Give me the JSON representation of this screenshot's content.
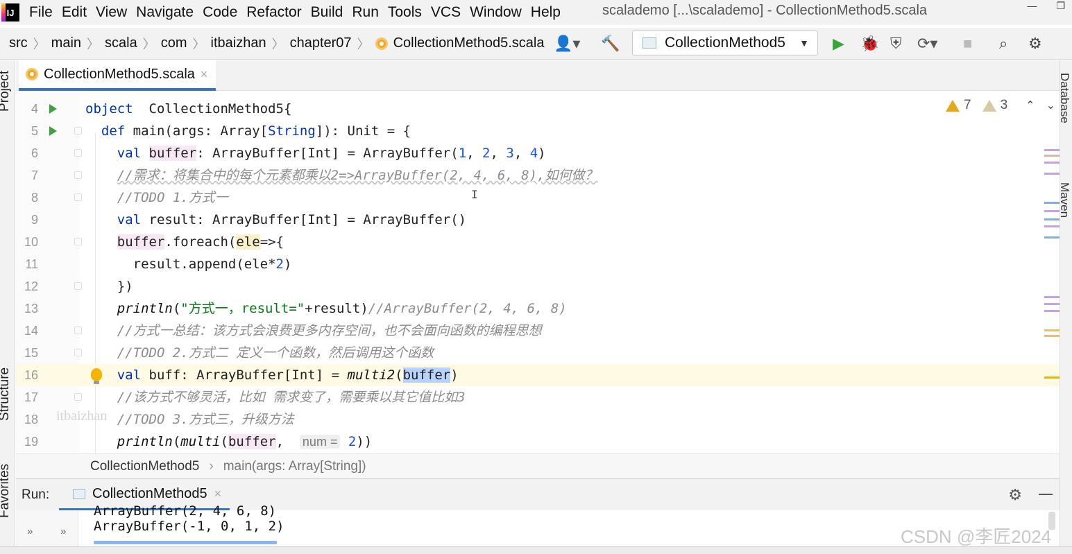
{
  "menubar": {
    "items": [
      "File",
      "Edit",
      "View",
      "Navigate",
      "Code",
      "Refactor",
      "Build",
      "Run",
      "Tools",
      "VCS",
      "Window",
      "Help"
    ],
    "window_title": "scalademo [...\\scalademo] - CollectionMethod5.scala"
  },
  "breadcrumb": [
    "src",
    "main",
    "scala",
    "com",
    "itbaizhan",
    "chapter07",
    "CollectionMethod5.scala"
  ],
  "run_config": {
    "label": "CollectionMethod5"
  },
  "left_tools": [
    "Project",
    "Structure",
    "Favorites"
  ],
  "right_tools": [
    "Database",
    "Maven"
  ],
  "editor": {
    "tab_label": "CollectionMethod5.scala",
    "inspections": {
      "warnings": "7",
      "weak_warnings": "3"
    },
    "lines": [
      {
        "n": "4",
        "segs": [
          [
            "kw",
            "object"
          ],
          [
            "",
            "  CollectionMethod5{"
          ]
        ]
      },
      {
        "n": "5",
        "segs": [
          [
            "",
            "  "
          ],
          [
            "kw",
            "def"
          ],
          [
            "",
            " main(args: Array["
          ],
          [
            "kw",
            "String"
          ],
          [
            "",
            "]): Unit = {"
          ]
        ]
      },
      {
        "n": "6",
        "segs": [
          [
            "",
            "    "
          ],
          [
            "kw",
            "val"
          ],
          [
            "",
            " "
          ],
          [
            "hl-var",
            "buffer"
          ],
          [
            "",
            ": ArrayBuffer[Int] = ArrayBuffer("
          ],
          [
            "num",
            "1"
          ],
          [
            "",
            ", "
          ],
          [
            "num",
            "2"
          ],
          [
            "",
            ", "
          ],
          [
            "num",
            "3"
          ],
          [
            "",
            ", "
          ],
          [
            "num",
            "4"
          ],
          [
            "",
            ")"
          ]
        ]
      },
      {
        "n": "7",
        "segs": [
          [
            "",
            "    "
          ],
          [
            "cmt squiggle",
            "//需求：将集合中的每个元素都乘以2=>ArrayBuffer(2, 4, 6, 8),如何做？"
          ]
        ]
      },
      {
        "n": "8",
        "segs": [
          [
            "",
            "    "
          ],
          [
            "cmt",
            "//TODO 1.方式一"
          ]
        ]
      },
      {
        "n": "9",
        "segs": [
          [
            "",
            "    "
          ],
          [
            "kw",
            "val"
          ],
          [
            "",
            " result: ArrayBuffer[Int] = ArrayBuffer()"
          ]
        ]
      },
      {
        "n": "10",
        "segs": [
          [
            "",
            "    "
          ],
          [
            "hl-var",
            "buffer"
          ],
          [
            "",
            ".foreach("
          ],
          [
            "hl-ele",
            "ele"
          ],
          [
            "",
            "=>{"
          ]
        ]
      },
      {
        "n": "11",
        "segs": [
          [
            "",
            "      result.append(ele*"
          ],
          [
            "num",
            "2"
          ],
          [
            "",
            ")"
          ]
        ]
      },
      {
        "n": "12",
        "segs": [
          [
            "",
            "    })"
          ]
        ]
      },
      {
        "n": "13",
        "segs": [
          [
            "",
            "    "
          ],
          [
            "fn",
            "println"
          ],
          [
            "",
            "("
          ],
          [
            "str",
            "\"方式一，result=\""
          ],
          [
            "",
            "+result)"
          ],
          [
            "cmt",
            "//ArrayBuffer(2, 4, 6, 8)"
          ]
        ]
      },
      {
        "n": "14",
        "segs": [
          [
            "",
            "    "
          ],
          [
            "cmt",
            "//方式一总结：该方式会浪费更多内存空间，也不会面向函数的编程思想"
          ]
        ]
      },
      {
        "n": "15",
        "segs": [
          [
            "",
            "    "
          ],
          [
            "cmt",
            "//TODO 2.方式二 定义一个函数，然后调用这个函数"
          ]
        ]
      },
      {
        "n": "16",
        "segs": [
          [
            "",
            "    "
          ],
          [
            "kw",
            "val"
          ],
          [
            "",
            " buff: ArrayBuffer[Int] = "
          ],
          [
            "fn",
            "multi2"
          ],
          [
            "",
            "("
          ],
          [
            "hl-sel",
            "buffer"
          ],
          [
            "",
            ")"
          ]
        ]
      },
      {
        "n": "17",
        "segs": [
          [
            "",
            "    "
          ],
          [
            "cmt",
            "//该方式不够灵活，比如 需求变了，需要乘以其它值比如3"
          ]
        ]
      },
      {
        "n": "18",
        "segs": [
          [
            "",
            "    "
          ],
          [
            "cmt",
            "//TODO 3.方式三，升级方法"
          ]
        ]
      },
      {
        "n": "19",
        "segs": [
          [
            "",
            "    "
          ],
          [
            "fn",
            "println"
          ],
          [
            "",
            "("
          ],
          [
            "fn",
            "multi"
          ],
          [
            "",
            "("
          ],
          [
            "hl-var",
            "buffer"
          ],
          [
            "",
            ",  "
          ],
          [
            "hint",
            "num ="
          ],
          [
            "",
            ""
          ],
          [
            "num",
            " 2"
          ],
          [
            "",
            "))"
          ]
        ]
      }
    ],
    "watermark": "itbaizhan"
  },
  "code_crumbs": [
    "CollectionMethod5",
    "main(args: Array[String])"
  ],
  "run_panel": {
    "label": "Run:",
    "tab_label": "CollectionMethod5",
    "prev_output": "ArrayBuffer(2, 4, 6, 8)",
    "output": "ArrayBuffer(-1, 0, 1, 2)"
  },
  "watermark_csdn": "CSDN @李匠2024"
}
